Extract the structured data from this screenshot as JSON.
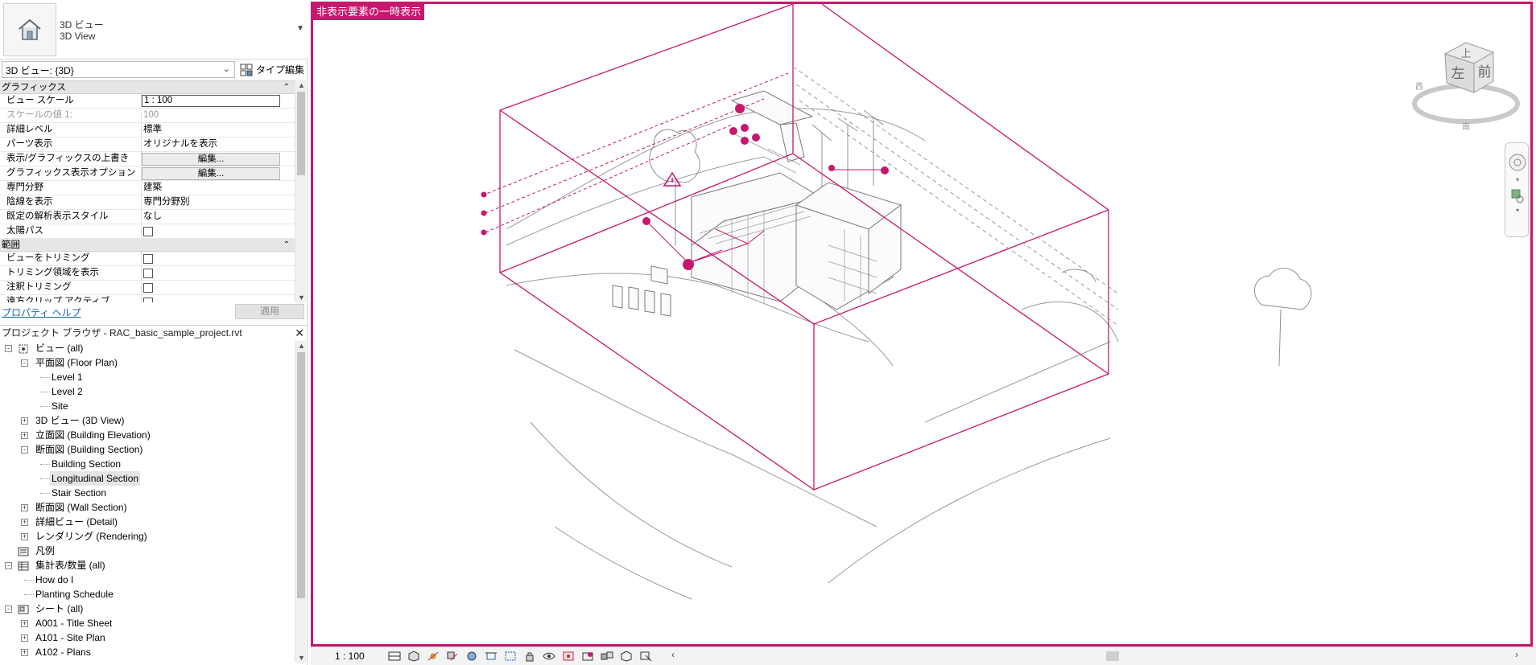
{
  "type_selector": {
    "name_line1": "3D ビュー",
    "name_line2": "3D View",
    "icon": "house-icon"
  },
  "view_selector": {
    "value": "3D ビュー: {3D}",
    "type_edit_label": "タイプ編集"
  },
  "properties": {
    "groups": [
      {
        "name": "グラフィックス",
        "rows": [
          {
            "label": "ビュー スケール",
            "value": "1 : 100",
            "kind": "input"
          },
          {
            "label": "スケールの値    1:",
            "value": "100",
            "kind": "text",
            "dim": true
          },
          {
            "label": "詳細レベル",
            "value": "標準",
            "kind": "text"
          },
          {
            "label": "パーツ表示",
            "value": "オリジナルを表示",
            "kind": "text"
          },
          {
            "label": "表示/グラフィックスの上書き",
            "value": "編集...",
            "kind": "button"
          },
          {
            "label": "グラフィックス表示オプション",
            "value": "編集...",
            "kind": "button"
          },
          {
            "label": "専門分野",
            "value": "建築",
            "kind": "text"
          },
          {
            "label": "陰線を表示",
            "value": "専門分野別",
            "kind": "text"
          },
          {
            "label": "既定の解析表示スタイル",
            "value": "なし",
            "kind": "text"
          },
          {
            "label": "太陽パス",
            "value": "",
            "kind": "checkbox"
          }
        ]
      },
      {
        "name": "範囲",
        "rows": [
          {
            "label": "ビューをトリミング",
            "value": "",
            "kind": "checkbox"
          },
          {
            "label": "トリミング領域を表示",
            "value": "",
            "kind": "checkbox"
          },
          {
            "label": "注釈トリミング",
            "value": "",
            "kind": "checkbox"
          },
          {
            "label": "遠方クリップ アクティブ",
            "value": "",
            "kind": "checkbox"
          }
        ]
      }
    ],
    "help_link": "プロパティ ヘルプ",
    "apply_label": "適用"
  },
  "project_browser": {
    "title": "プロジェクト ブラウザ - RAC_basic_sample_project.rvt",
    "nodes": [
      {
        "label": "ビュー (all)",
        "depth": 0,
        "exp": "-",
        "icon": "views-icon"
      },
      {
        "label": "平面図 (Floor Plan)",
        "depth": 1,
        "exp": "-"
      },
      {
        "label": "Level 1",
        "depth": 2,
        "exp": ""
      },
      {
        "label": "Level 2",
        "depth": 2,
        "exp": ""
      },
      {
        "label": "Site",
        "depth": 2,
        "exp": ""
      },
      {
        "label": "3D ビュー (3D View)",
        "depth": 1,
        "exp": "+"
      },
      {
        "label": "立面図 (Building Elevation)",
        "depth": 1,
        "exp": "+"
      },
      {
        "label": "断面図 (Building Section)",
        "depth": 1,
        "exp": "-"
      },
      {
        "label": "Building Section",
        "depth": 2,
        "exp": ""
      },
      {
        "label": "Longitudinal Section",
        "depth": 2,
        "exp": "",
        "selected": true
      },
      {
        "label": "Stair Section",
        "depth": 2,
        "exp": ""
      },
      {
        "label": "断面図 (Wall Section)",
        "depth": 1,
        "exp": "+"
      },
      {
        "label": "詳細ビュー (Detail)",
        "depth": 1,
        "exp": "+"
      },
      {
        "label": "レンダリング (Rendering)",
        "depth": 1,
        "exp": "+"
      },
      {
        "label": "凡例",
        "depth": 0,
        "exp": "",
        "icon": "legend-icon"
      },
      {
        "label": "集計表/数量 (all)",
        "depth": 0,
        "exp": "-",
        "icon": "schedule-icon"
      },
      {
        "label": "How do I",
        "depth": 1,
        "exp": ""
      },
      {
        "label": "Planting Schedule",
        "depth": 1,
        "exp": ""
      },
      {
        "label": "シート (all)",
        "depth": 0,
        "exp": "-",
        "icon": "sheets-icon"
      },
      {
        "label": "A001 - Title Sheet",
        "depth": 1,
        "exp": "+"
      },
      {
        "label": "A101 - Site Plan",
        "depth": 1,
        "exp": "+"
      },
      {
        "label": "A102 - Plans",
        "depth": 1,
        "exp": "+"
      }
    ]
  },
  "viewport": {
    "banner": "非表示要素の一時表示",
    "border_color": "#c8176e",
    "viewcube": {
      "top": "上",
      "front": "前",
      "left": "左",
      "west": "西",
      "south": "南"
    }
  },
  "status_bar": {
    "scale": "1 : 100"
  }
}
